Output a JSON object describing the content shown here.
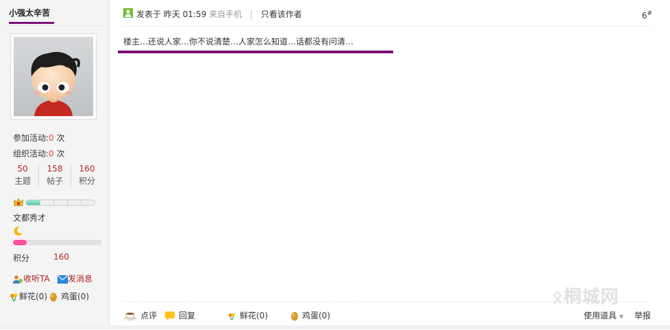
{
  "user": {
    "name": "小强太辛苦",
    "activities_joined_label": "参加活动:",
    "activities_joined": "0",
    "activities_unit": "次",
    "activities_organized_label": "组织活动:",
    "activities_organized": "0",
    "organized_unit": "次",
    "counts": [
      {
        "value": "50",
        "label": "主题"
      },
      {
        "value": "158",
        "label": "帖子"
      },
      {
        "value": "160",
        "label": "积分"
      }
    ],
    "level_progress": 0.2,
    "rank_name": "文都秀才",
    "points_progress": 0.15,
    "score_label": "积分",
    "score_value": "160",
    "follow_label": "收听TA",
    "message_label": "发消息",
    "flowers_label": "鲜花(0)",
    "eggs_label": "鸡蛋(0)"
  },
  "post": {
    "posted_prefix": "发表于",
    "posted_time": "昨天 01:59",
    "posted_source": "来自手机",
    "separator": "|",
    "author_only_label": "只看该作者",
    "floor_number": "6",
    "floor_symbol": "#",
    "content": "楼主…还说人家…你不说清楚…人家怎么知道…话都没有问清…"
  },
  "footer": {
    "comment_label": "点评",
    "reply_label": "回复",
    "flowers_label": "鲜花(0)",
    "eggs_label": "鸡蛋(0)",
    "tools_label": "使用道具",
    "report_label": "举报"
  },
  "watermark": "桐城网",
  "colors": {
    "accent_purple": "#7b1178",
    "count_red": "#b22222",
    "pink_bar": "#ff4fa3",
    "level_green": "#5cc7a8"
  }
}
